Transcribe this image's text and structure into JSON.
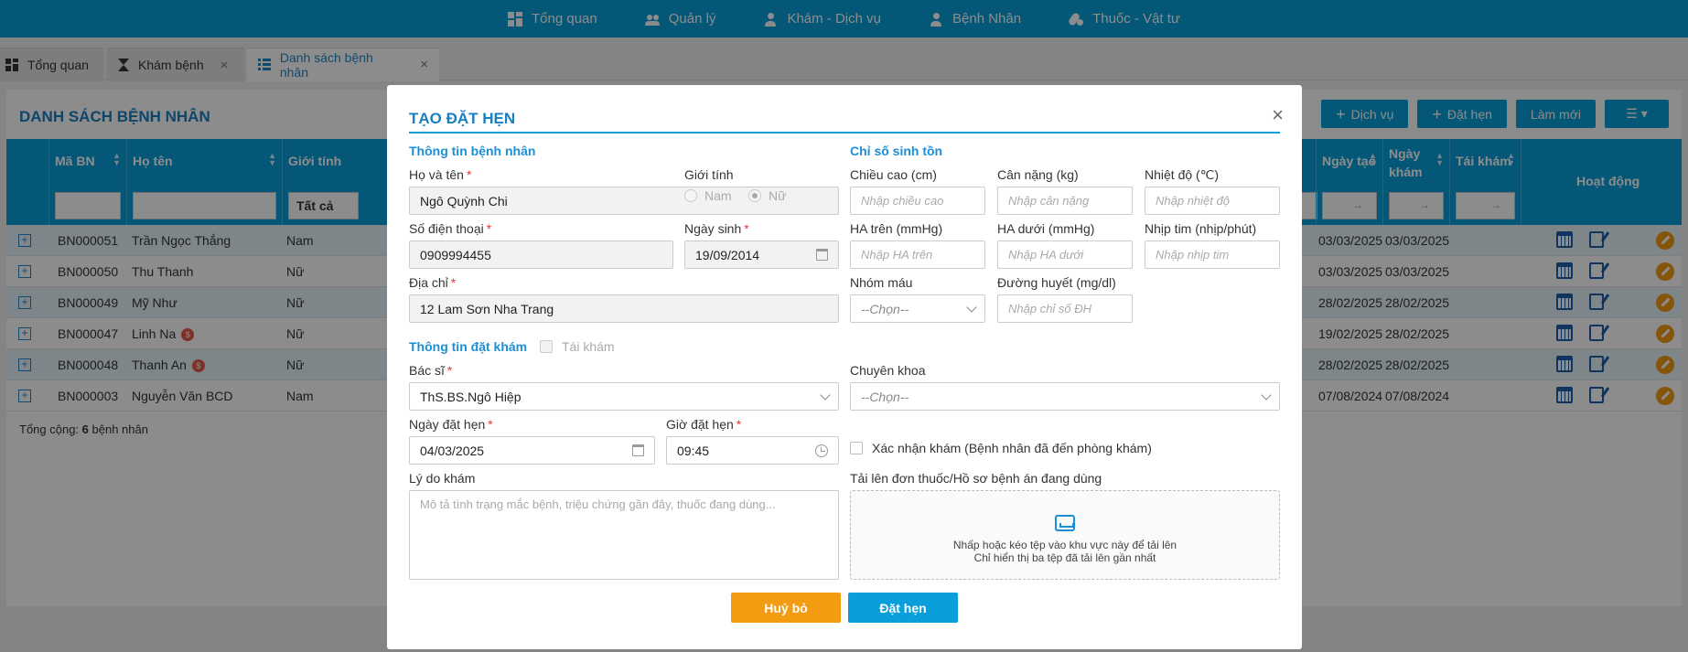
{
  "topnav": {
    "items": [
      {
        "label": "Tổng quan",
        "icon": "dashboard-icon"
      },
      {
        "label": "Quản lý",
        "icon": "people-icon"
      },
      {
        "label": "Khám - Dịch vụ",
        "icon": "doctor-icon"
      },
      {
        "label": "Bệnh Nhân",
        "icon": "patient-icon"
      },
      {
        "label": "Thuốc - Vật tư",
        "icon": "pills-icon"
      }
    ]
  },
  "tabs": [
    {
      "label": "Tổng quan"
    },
    {
      "label": "Khám bệnh",
      "close": "×"
    },
    {
      "label": "Danh sách bệnh nhân",
      "close": "×"
    }
  ],
  "list": {
    "title": "DANH SÁCH BỆNH NHÂN",
    "toolbar": {
      "service": "Dịch vụ",
      "appointment": "Đặt hẹn",
      "refresh": "Làm mới"
    },
    "columns": {
      "code": "Mã BN",
      "name": "Họ tên",
      "gender": "Giới tính",
      "created": "Ngày tạo",
      "visit_1": "Ngày",
      "visit_2": "khám",
      "revisit": "Tái khám",
      "actions": "Hoạt động"
    },
    "gender_filter": "Tất cả",
    "date_filter": "→",
    "rows": [
      {
        "code": "BN000051",
        "name": "Trần Ngọc Thắng",
        "gender": "Nam",
        "created": "03/03/2025",
        "visit": "03/03/2025",
        "coin": ""
      },
      {
        "code": "BN000050",
        "name": "Thu Thanh",
        "gender": "Nữ",
        "created": "03/03/2025",
        "visit": "03/03/2025",
        "coin": ""
      },
      {
        "code": "BN000049",
        "name": "Mỹ Như",
        "gender": "Nữ",
        "created": "28/02/2025",
        "visit": "28/02/2025",
        "coin": ""
      },
      {
        "code": "BN000047",
        "name": "Linh Na",
        "gender": "Nữ",
        "created": "19/02/2025",
        "visit": "28/02/2025",
        "coin": "$"
      },
      {
        "code": "BN000048",
        "name": "Thanh An",
        "gender": "Nữ",
        "created": "28/02/2025",
        "visit": "28/02/2025",
        "coin": "$"
      },
      {
        "code": "BN000003",
        "name": "Nguyễn Văn BCD",
        "gender": "Nam",
        "created": "07/08/2024",
        "visit": "07/08/2024",
        "coin": ""
      }
    ],
    "footer_prefix": "Tổng cộng: ",
    "footer_count": "6",
    "footer_suffix": " bệnh nhân"
  },
  "modal": {
    "title": "TẠO ĐẶT HẸN",
    "close": "×",
    "patient_section": "Thông tin bệnh nhân",
    "vitals_section": "Chỉ số sinh tồn",
    "booking_section": "Thông tin đặt khám",
    "revisit_label": "Tái khám",
    "fields": {
      "fullname_label": "Họ và tên",
      "fullname": "Ngô Quỳnh Chi",
      "gender_label": "Giới tính",
      "male": "Nam",
      "female": "Nữ",
      "phone_label": "Số điện thoại",
      "phone": "0909994455",
      "dob_label": "Ngày sinh",
      "dob": "19/09/2014",
      "address_label": "Địa chỉ",
      "address": "12 Lam Sơn Nha Trang",
      "height_label": "Chiều cao (cm)",
      "height_ph": "Nhập chiều cao",
      "weight_label": "Cân nặng (kg)",
      "weight_ph": "Nhập cân nặng",
      "temp_label": "Nhiệt độ (℃)",
      "temp_ph": "Nhập nhiệt độ",
      "bp_high_label": "HA trên (mmHg)",
      "bp_high_ph": "Nhập HA trên",
      "bp_low_label": "HA dưới (mmHg)",
      "bp_low_ph": "Nhập HA dưới",
      "pulse_label": "Nhịp tim (nhịp/phút)",
      "pulse_ph": "Nhập nhịp tim",
      "blood_label": "Nhóm máu",
      "blood": "--Chọn--",
      "sugar_label": "Đường huyết (mg/dl)",
      "sugar_ph": "Nhập chỉ số ĐH",
      "doctor_label": "Bác sĩ",
      "doctor": "ThS.BS.Ngô Hiệp",
      "specialty_label": "Chuyên khoa",
      "specialty": "--Chọn--",
      "date_label": "Ngày đặt hẹn",
      "date": "04/03/2025",
      "time_label": "Giờ đặt hẹn",
      "time": "09:45",
      "confirm_label": "Xác nhận khám (Bệnh nhân đã đến phòng khám)",
      "reason_label": "Lý do khám",
      "reason_ph": "Mô tả tình trạng mắc bệnh, triệu chứng gần đây, thuốc đang dùng...",
      "upload_label": "Tải lên đơn thuốc/Hồ sơ bệnh án đang dùng",
      "upload_line1": "Nhấp hoặc kéo tệp vào khu vực này để tải lên",
      "upload_line2": "Chỉ hiển thị ba tệp đã tải lên gần nhất",
      "required_mark": "*"
    },
    "cancel": "Huỷ bỏ",
    "submit": "Đặt hẹn"
  },
  "colors": {
    "primary": "#0a9fdb",
    "title": "#1a7fc1",
    "cancel": "#f39c12",
    "submit": "#0a9fdb"
  }
}
